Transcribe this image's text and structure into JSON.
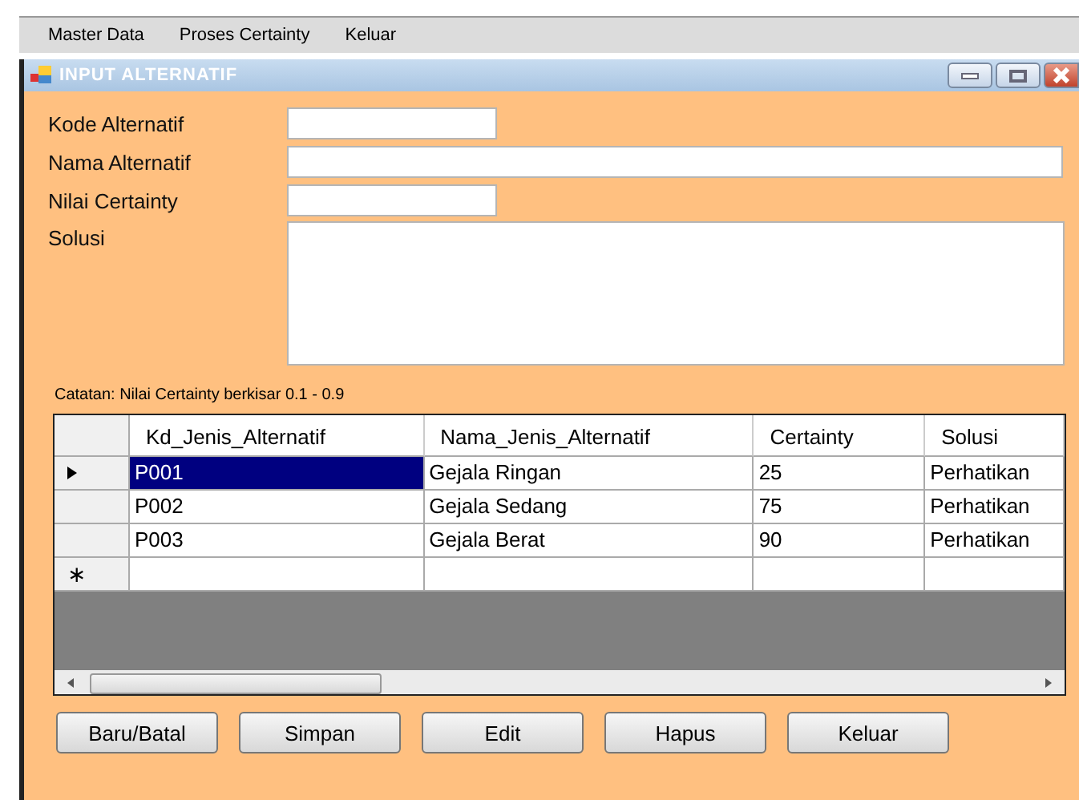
{
  "menu": [
    "Master Data",
    "Proses Certainty",
    "Keluar"
  ],
  "window": {
    "title": "INPUT ALTERNATIF"
  },
  "fields": [
    {
      "label": "Kode Alternatif",
      "kind": "short"
    },
    {
      "label": "Nama Alternatif",
      "kind": "long"
    },
    {
      "label": "Nilai Certainty",
      "kind": "short"
    },
    {
      "label": "Solusi",
      "kind": "multiline"
    }
  ],
  "note": "Catatan: Nilai Certainty berkisar 0.1 - 0.9",
  "table": {
    "columns": [
      "Kd_Jenis_Alternatif",
      "Nama_Jenis_Alternatif",
      "Certainty",
      "Solusi"
    ],
    "rows": [
      {
        "cells": [
          "P001",
          "Gejala Ringan",
          "25",
          "Perhatikan"
        ],
        "selected": true
      },
      {
        "cells": [
          "P002",
          "Gejala Sedang",
          "75",
          "Perhatikan"
        ],
        "selected": false
      },
      {
        "cells": [
          "P003",
          "Gejala Berat",
          "90",
          "Perhatikan"
        ],
        "selected": false
      }
    ],
    "new_row_marker": "∗"
  },
  "buttons": [
    "Baru/Batal",
    "Simpan",
    "Edit",
    "Hapus",
    "Keluar"
  ]
}
